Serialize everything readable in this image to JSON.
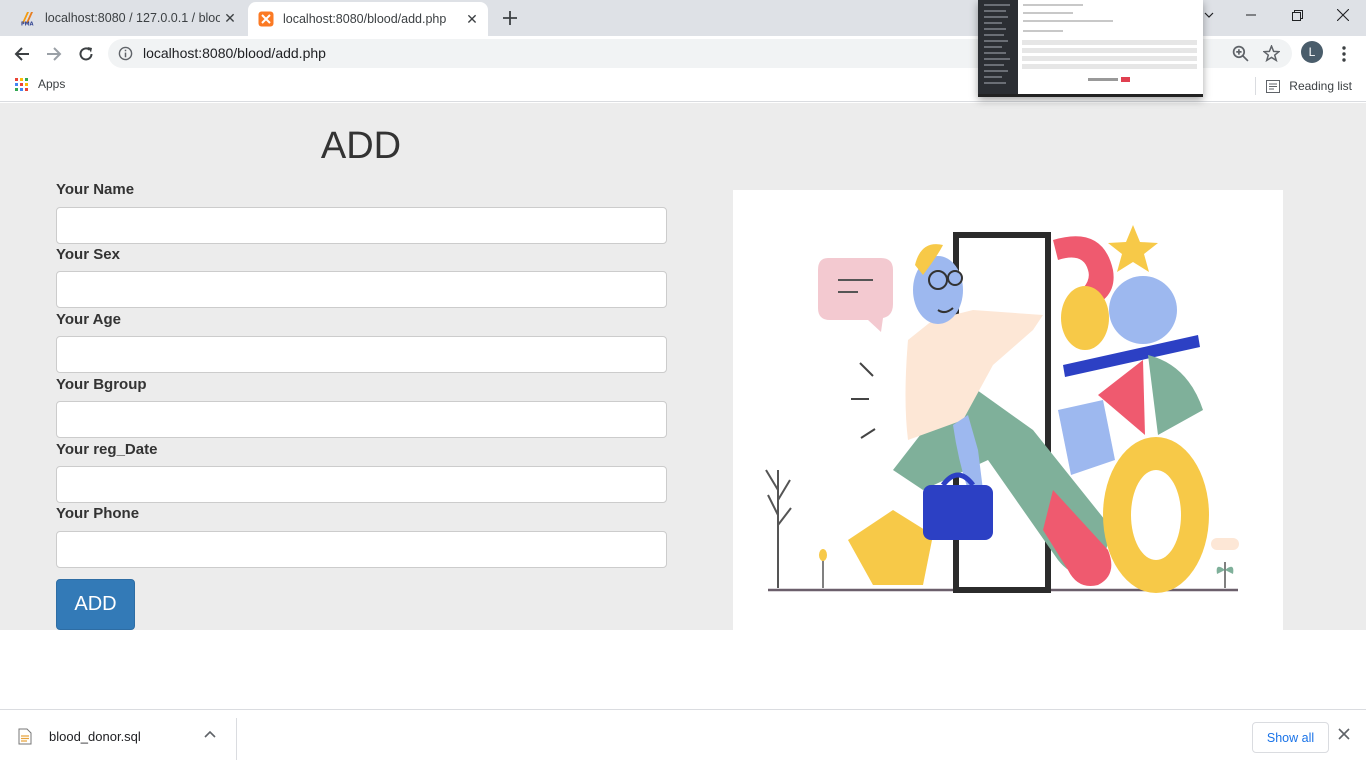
{
  "browser": {
    "tabs": [
      {
        "title": "localhost:8080 / 127.0.0.1 / blood",
        "favicon": "phpmyadmin-icon"
      },
      {
        "title": "localhost:8080/blood/add.php",
        "favicon": "xampp-icon"
      }
    ],
    "url": "localhost:8080/blood/add.php",
    "profile_initial": "L"
  },
  "bookmarks": {
    "apps_label": "Apps",
    "reading_list_label": "Reading list"
  },
  "form": {
    "title": "ADD",
    "fields": [
      {
        "label": "Your Name",
        "value": ""
      },
      {
        "label": "Your Sex",
        "value": ""
      },
      {
        "label": "Your Age",
        "value": ""
      },
      {
        "label": "Your Bgroup",
        "value": ""
      },
      {
        "label": "Your reg_Date",
        "value": ""
      },
      {
        "label": "Your Phone",
        "value": ""
      }
    ],
    "submit_label": "ADD"
  },
  "downloads": {
    "file_name": "blood_donor.sql",
    "show_all_label": "Show all"
  },
  "colors": {
    "accent_button": "#337ab7",
    "page_background": "#ececec",
    "tabstrip": "#dee1e6"
  }
}
